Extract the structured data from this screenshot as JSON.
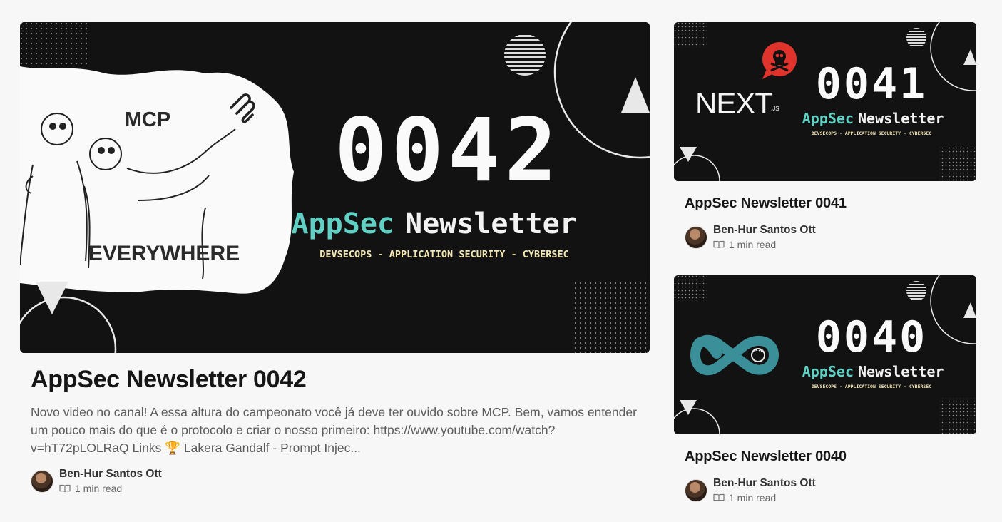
{
  "main_post": {
    "cover": {
      "left_top_word": "MCP",
      "left_bottom_word": "EVERYWHERE",
      "issue_number": "0042",
      "brand_accent": "AppSec",
      "brand_rest": "Newsletter",
      "tagline": "DEVSECOPS - APPLICATION SECURITY - CYBERSEC"
    },
    "title": "AppSec Newsletter 0042",
    "excerpt": "Novo video no canal! A essa altura do campeonato você já deve ter ouvido sobre MCP. Bem, vamos entender um pouco mais do que é o protocolo e criar o nosso primeiro: https://www.youtube.com/watch?v=hT72pLOLRaQ Links 🏆 Lakera Gandalf - Prompt Injec...",
    "author": "Ben-Hur Santos Ott",
    "read_time": "1 min read"
  },
  "side_posts": [
    {
      "cover": {
        "logo_text": "NEXT",
        "logo_suffix": ".JS",
        "issue_number": "0041",
        "brand_accent": "AppSec",
        "brand_rest": "Newsletter",
        "tagline": "DEVSECOPS - APPLICATION SECURITY - CYBERSEC"
      },
      "title": "AppSec Newsletter 0041",
      "author": "Ben-Hur Santos Ott",
      "read_time": "1 min read"
    },
    {
      "cover": {
        "issue_number": "0040",
        "brand_accent": "AppSec",
        "brand_rest": "Newsletter",
        "tagline": "DEVSECOPS - APPLICATION SECURITY - CYBERSEC"
      },
      "title": "AppSec Newsletter 0040",
      "author": "Ben-Hur Santos Ott",
      "read_time": "1 min read"
    }
  ],
  "colors": {
    "cover_bg": "#121212",
    "accent_teal": "#5fd0c3",
    "tagline_cream": "#f3e6b0",
    "skull_red": "#e0332b",
    "infinity_teal": "#3b8f98"
  },
  "icons": [
    "book-open-icon",
    "skull-icon",
    "github-icon",
    "mcp-logo-icon",
    "infinity-logo-icon"
  ]
}
